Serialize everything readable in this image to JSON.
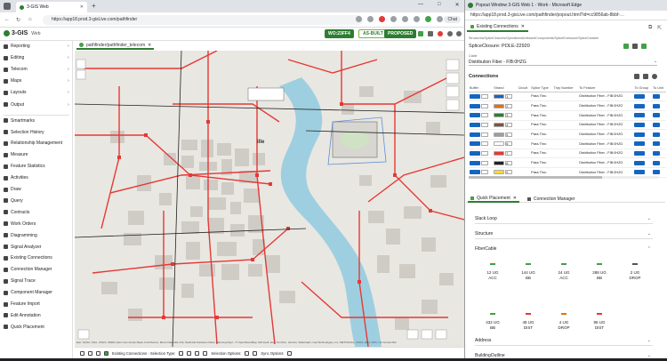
{
  "colors": {
    "brand_green": "#2e7d32",
    "fiber_red": "#e53935",
    "river": "#9ecfe0",
    "blue": "#1565c0"
  },
  "left_window": {
    "tab_title": "3-GIS Web",
    "url": "https://app18.prod.3-gisLive.com/pathfinder",
    "chat_label": "Chat",
    "app": {
      "logo": "3-GIS",
      "logo_sub": "Web",
      "wo": "WO:23FF4",
      "as_built": "AS-BUILT",
      "proposed": "PROPOSED"
    },
    "sidebar": [
      {
        "label": "Reporting",
        "icon": "reporting-icon",
        "arrow": true
      },
      {
        "label": "Editing",
        "icon": "editing-icon",
        "arrow": true
      },
      {
        "label": "Telecom",
        "icon": "telecom-icon",
        "arrow": true
      },
      {
        "label": "Maps",
        "icon": "maps-icon",
        "arrow": true
      },
      {
        "label": "Layouts",
        "icon": "layouts-icon",
        "arrow": true
      },
      {
        "label": "Output",
        "icon": "output-icon",
        "arrow": true
      },
      {
        "label": "Smartmarks",
        "icon": "smartmarks-icon"
      },
      {
        "label": "Selection History",
        "icon": "history-icon"
      },
      {
        "label": "Relationship Management",
        "icon": "relationship-icon"
      },
      {
        "label": "Measure",
        "icon": "measure-icon"
      },
      {
        "label": "Feature Statistics",
        "icon": "statistics-icon"
      },
      {
        "label": "Activities",
        "icon": "activities-icon"
      },
      {
        "label": "Draw",
        "icon": "draw-icon"
      },
      {
        "label": "Query",
        "icon": "query-icon"
      },
      {
        "label": "Contracts",
        "icon": "contracts-icon"
      },
      {
        "label": "Work Orders",
        "icon": "work-orders-icon"
      },
      {
        "label": "Diagramming",
        "icon": "diagramming-icon"
      },
      {
        "label": "Signal Analyzer",
        "icon": "signal-analyzer-icon"
      },
      {
        "label": "Existing Connections",
        "icon": "existing-connections-icon"
      },
      {
        "label": "Connection Manager",
        "icon": "connection-manager-icon"
      },
      {
        "label": "Signal Trace",
        "icon": "signal-trace-icon"
      },
      {
        "label": "Component Manager",
        "icon": "component-manager-icon"
      },
      {
        "label": "Feature Import",
        "icon": "feature-import-icon"
      },
      {
        "label": "Edit Annotation",
        "icon": "edit-annotation-icon"
      },
      {
        "label": "Quick Placement",
        "icon": "quick-placement-icon"
      }
    ],
    "map_tab": "pathfinder/pathfinder_telecom",
    "map_label": "ille",
    "attribution": "Esri, NASA, NGA, USGS, FEMA | Esri Community Maps Contributors, Metro Nashville GIS, Nashville Davidson Metro Planning Dept., © OpenStreetMap, Microsoft, Esri, TomTom, Garmin, SafeGraph, GeoTechnologies, Inc, METI/NASA, USGS, EPA, NPS, US Census Bureau, USDA",
    "bottom_toolbar": {
      "existing": "Existing Connections - Selection Type:",
      "selection": "Selection Options:",
      "sync": "Sync Options:"
    }
  },
  "right_window": {
    "title": "Popout Window 3-GIS Web 1 - Work - Microsoft Edge",
    "url": "https://app18.prod.3-gisLive.com/pathfinder/popout.html?id=cc9856ab-8bbf-…",
    "tab": "Existing Connections",
    "breadcrumb": "Structures/SpliceClosures/OperationalUnitsandComponents/SpliceEnclosure/SpliceCanister",
    "splice": "SpliceClosure: POLE-22920",
    "cable_label": "Cable",
    "cable_value": "Distribution Fiber - FIB:0HZG",
    "connections_title": "Connections",
    "columns": [
      "Buffer",
      "Strand",
      "Circuit",
      "Splice Type",
      "Tray Number",
      "To Feature",
      "To Group",
      "To Unit"
    ],
    "rows": [
      {
        "buffer": "#1565c0",
        "strand": "#1565c0",
        "strand_n": "1",
        "splice": "Pass Thru",
        "to": "Distribution Fiber - FIB:0HZG"
      },
      {
        "buffer": "#1565c0",
        "strand": "#ef6c00",
        "strand_n": "2",
        "splice": "Pass Thru",
        "to": "Distribution Fiber - FIB:0HZG"
      },
      {
        "buffer": "#1565c0",
        "strand": "#2e7d32",
        "strand_n": "3",
        "splice": "Pass Thru",
        "to": "Distribution Fiber - FIB:0HZG"
      },
      {
        "buffer": "#1565c0",
        "strand": "#795548",
        "strand_n": "4",
        "splice": "Pass Thru",
        "to": "Distribution Fiber - FIB:0HZG"
      },
      {
        "buffer": "#1565c0",
        "strand": "#9e9e9e",
        "strand_n": "5",
        "splice": "Pass Thru",
        "to": "Distribution Fiber - FIB:0HZG"
      },
      {
        "buffer": "#1565c0",
        "strand": "#ffffff",
        "strand_n": "6",
        "splice": "Pass Thru",
        "to": "Distribution Fiber - FIB:0HZG"
      },
      {
        "buffer": "#1565c0",
        "strand": "#e53935",
        "strand_n": "7",
        "splice": "Pass Thru",
        "to": "Distribution Fiber - FIB:0HZG"
      },
      {
        "buffer": "#1565c0",
        "strand": "#212121",
        "strand_n": "8",
        "splice": "Pass Thru",
        "to": "Distribution Fiber - FIB:0HZG"
      },
      {
        "buffer": "#1565c0",
        "strand": "#fdd835",
        "strand_n": "9",
        "splice": "Pass Thru",
        "to": "Distribution Fiber - FIB:0HZG"
      }
    ],
    "bottom_tabs": [
      "Quick Placement",
      "Connection Manager"
    ],
    "sections": {
      "splice_loop": "Slack Loop",
      "structure": "Structure",
      "fibercable": "FiberCable",
      "address": "Address",
      "building": "BuildingOutline"
    },
    "cables": [
      {
        "l1": "12 UG",
        "l2": "ACC",
        "color": "#43a047"
      },
      {
        "l1": "144 UG",
        "l2": "BB",
        "color": "#43a047"
      },
      {
        "l1": "24 UG",
        "l2": "ACC",
        "color": "#43a047"
      },
      {
        "l1": "288 UG",
        "l2": "BB",
        "color": "#43a047"
      },
      {
        "l1": "2 UG",
        "l2": "DROP",
        "color": "#555555"
      },
      {
        "l1": "432 UG",
        "l2": "BB",
        "color": "#43a047"
      },
      {
        "l1": "48 UG",
        "l2": "DIST",
        "color": "#e53935"
      },
      {
        "l1": "4 UG",
        "l2": "DROP",
        "color": "#ef6c00"
      },
      {
        "l1": "96 UG",
        "l2": "DIST",
        "color": "#e53935"
      }
    ]
  }
}
